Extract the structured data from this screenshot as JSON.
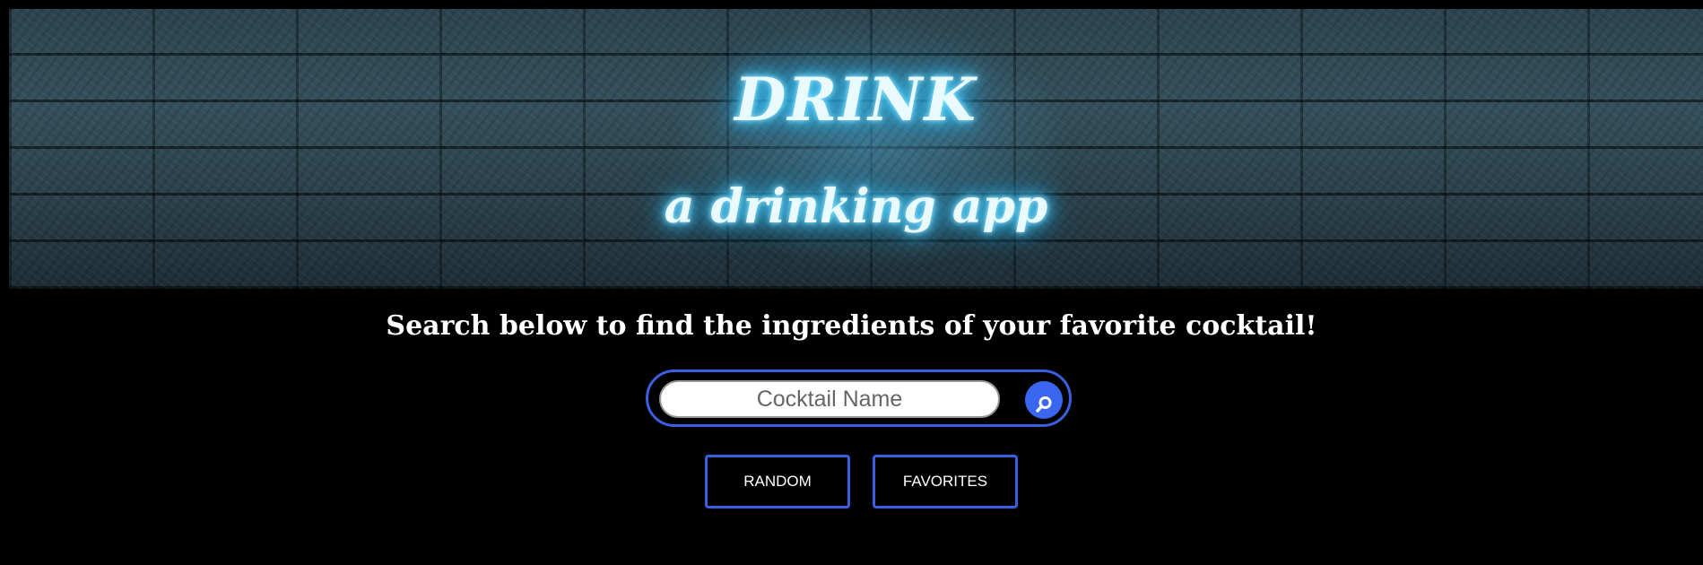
{
  "hero": {
    "title": "DRINK",
    "subtitle": "a drinking app"
  },
  "tagline": "Search below to find the ingredients of your favorite cocktail!",
  "search": {
    "placeholder": "Cocktail Name",
    "value": "",
    "button_icon": "search-icon"
  },
  "actions": {
    "random_label": "RANDOM",
    "favorites_label": "FAVORITES"
  },
  "colors": {
    "accent": "#3b5fe0",
    "search_button": "#3b66f0",
    "neon_glow": "#4fd2ff",
    "background": "#000000"
  }
}
